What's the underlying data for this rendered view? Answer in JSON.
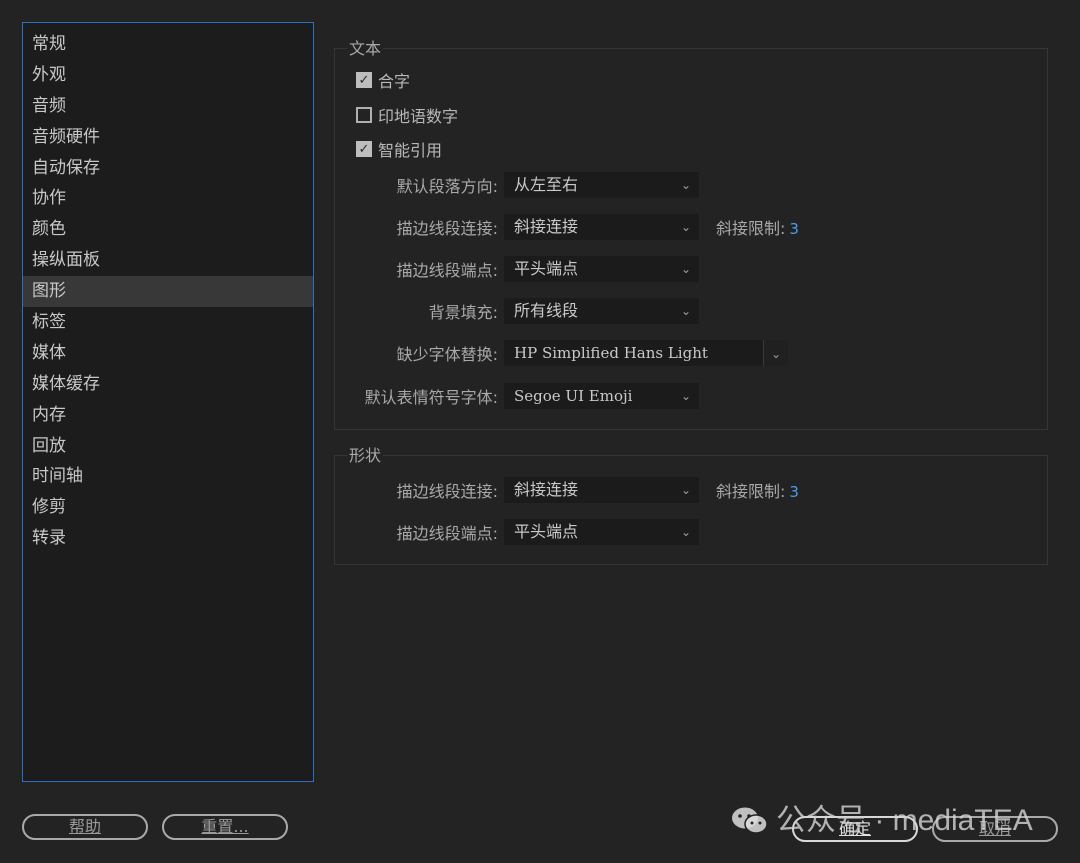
{
  "sidebar": {
    "items": [
      {
        "label": "常规"
      },
      {
        "label": "外观"
      },
      {
        "label": "音频"
      },
      {
        "label": "音频硬件"
      },
      {
        "label": "自动保存"
      },
      {
        "label": "协作"
      },
      {
        "label": "颜色"
      },
      {
        "label": "操纵面板"
      },
      {
        "label": "图形",
        "selected": true
      },
      {
        "label": "标签"
      },
      {
        "label": "媒体"
      },
      {
        "label": "媒体缓存"
      },
      {
        "label": "内存"
      },
      {
        "label": "回放"
      },
      {
        "label": "时间轴"
      },
      {
        "label": "修剪"
      },
      {
        "label": "转录"
      }
    ]
  },
  "text_group": {
    "title": "文本",
    "checkboxes": [
      {
        "label": "合字",
        "checked": true
      },
      {
        "label": "印地语数字",
        "checked": false
      },
      {
        "label": "智能引用",
        "checked": true
      }
    ],
    "para_direction": {
      "label": "默认段落方向:",
      "value": "从左至右"
    },
    "stroke_join": {
      "label": "描边线段连接:",
      "value": "斜接连接",
      "miter_label": "斜接限制:",
      "miter_value": "3"
    },
    "stroke_cap": {
      "label": "描边线段端点:",
      "value": "平头端点"
    },
    "background_fill": {
      "label": "背景填充:",
      "value": "所有线段"
    },
    "missing_font": {
      "label": "缺少字体替换:",
      "value": "HP Simplified Hans Light"
    },
    "emoji_font": {
      "label": "默认表情符号字体:",
      "value": "Segoe UI Emoji"
    }
  },
  "shape_group": {
    "title": "形状",
    "stroke_join": {
      "label": "描边线段连接:",
      "value": "斜接连接",
      "miter_label": "斜接限制:",
      "miter_value": "3"
    },
    "stroke_cap": {
      "label": "描边线段端点:",
      "value": "平头端点"
    }
  },
  "footer": {
    "help": "帮助",
    "reset": "重置...",
    "ok": "确定",
    "cancel": "取消"
  },
  "watermark": {
    "text": "公众号 · mediaTEA"
  },
  "icons": {
    "chevron": "chevron-down-icon",
    "check": "checkmark-icon",
    "wechat": "wechat-icon"
  },
  "colors": {
    "accent": "#2d6fc0",
    "value_blue": "#4a9cf0",
    "background": "#232323"
  }
}
